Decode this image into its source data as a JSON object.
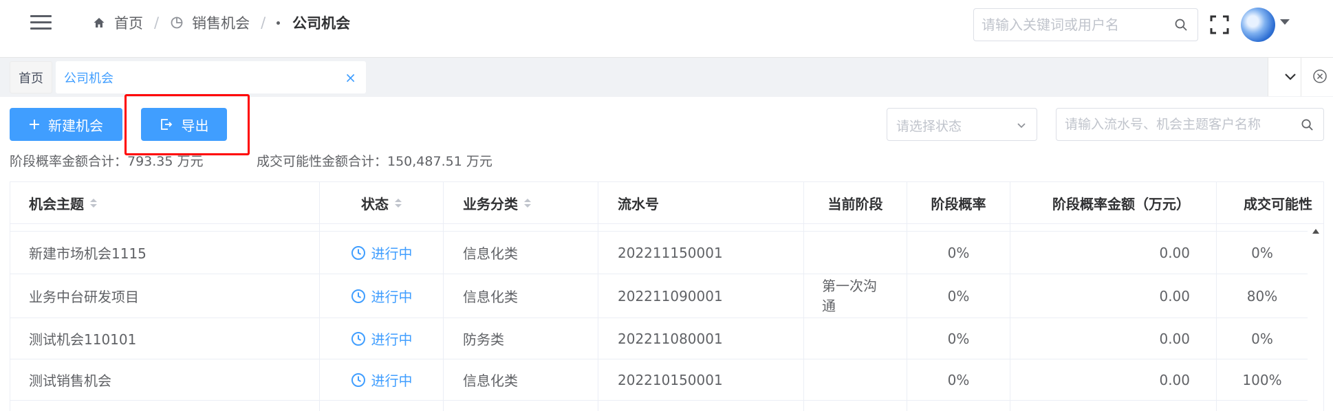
{
  "header": {
    "breadcrumb": {
      "home": "首页",
      "sep1": "/",
      "parent": "销售机会",
      "sep2": "/",
      "current": "公司机会"
    },
    "search_placeholder": "请输入关键词或用户名"
  },
  "tags": {
    "home": "首页",
    "active": "公司机会",
    "close": "×"
  },
  "toolbar": {
    "create_label": "新建机会",
    "export_label": "导出",
    "status_placeholder": "请选择状态",
    "search_placeholder": "请输入流水号、机会主题客户名称"
  },
  "summary": {
    "stage_amount": "阶段概率金额合计：793.35 万元",
    "deal_amount": "成交可能性金额合计：150,487.51 万元"
  },
  "table": {
    "columns": [
      "机会主题",
      "状态",
      "业务分类",
      "流水号",
      "当前阶段",
      "阶段概率",
      "阶段概率金额（万元）",
      "成交可能性"
    ],
    "rows": [
      {
        "subject": "新建市场机会1115",
        "status": "进行中",
        "category": "信息化类",
        "serial": "202211150001",
        "stage": "",
        "prob": "0%",
        "amount": "0.00",
        "possibility": "0%"
      },
      {
        "subject": "业务中台研发项目",
        "status": "进行中",
        "category": "信息化类",
        "serial": "202211090001",
        "stage": "第一次沟通",
        "prob": "0%",
        "amount": "0.00",
        "possibility": "80%"
      },
      {
        "subject": "测试机会110101",
        "status": "进行中",
        "category": "防务类",
        "serial": "202211080001",
        "stage": "",
        "prob": "0%",
        "amount": "0.00",
        "possibility": "0%"
      },
      {
        "subject": "测试销售机会",
        "status": "进行中",
        "category": "信息化类",
        "serial": "202210150001",
        "stage": "",
        "prob": "0%",
        "amount": "0.00",
        "possibility": "100%"
      }
    ]
  },
  "icons": {
    "menu": "hamburger-icon",
    "home": "home-icon",
    "chart": "pie-chart-icon",
    "search": "search-icon",
    "fullscreen": "fullscreen-icon",
    "avatar_caret": "caret-down-icon",
    "add": "plus-icon",
    "export": "export-icon",
    "status": "clock-icon"
  },
  "colors": {
    "primary": "#409eff",
    "highlight": "#ff0000",
    "tagbar_bg": "#f0f2f5"
  }
}
